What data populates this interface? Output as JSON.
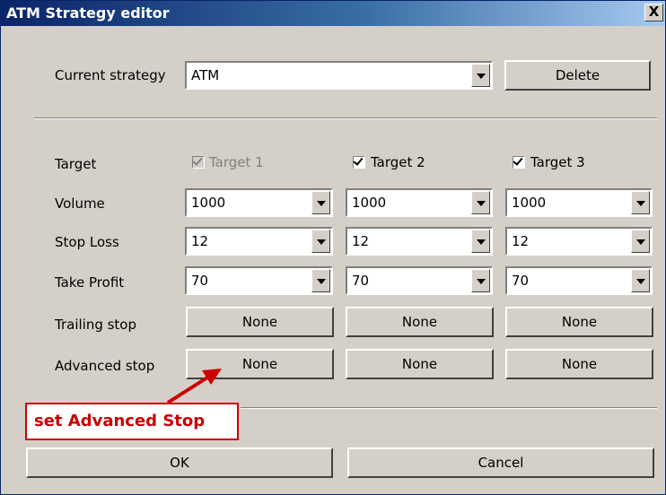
{
  "window": {
    "title": "ATM Strategy editor",
    "close_label": "X"
  },
  "strategy": {
    "label": "Current strategy",
    "value": "ATM",
    "delete_label": "Delete"
  },
  "rows": {
    "target": "Target",
    "volume": "Volume",
    "stop_loss": "Stop Loss",
    "take_profit": "Take Profit",
    "trailing_stop": "Trailing stop",
    "advanced_stop": "Advanced stop"
  },
  "targets": [
    {
      "label": "Target 1",
      "checked": true,
      "enabled": false,
      "volume": "1000",
      "stop_loss": "12",
      "take_profit": "70",
      "trailing": "None",
      "advanced": "None"
    },
    {
      "label": "Target 2",
      "checked": true,
      "enabled": true,
      "volume": "1000",
      "stop_loss": "12",
      "take_profit": "70",
      "trailing": "None",
      "advanced": "None"
    },
    {
      "label": "Target 3",
      "checked": true,
      "enabled": true,
      "volume": "1000",
      "stop_loss": "12",
      "take_profit": "70",
      "trailing": "None",
      "advanced": "None"
    }
  ],
  "annotation": {
    "text": "set Advanced Stop",
    "color": "#cc0000"
  },
  "footer": {
    "ok_label": "OK",
    "cancel_label": "Cancel"
  }
}
